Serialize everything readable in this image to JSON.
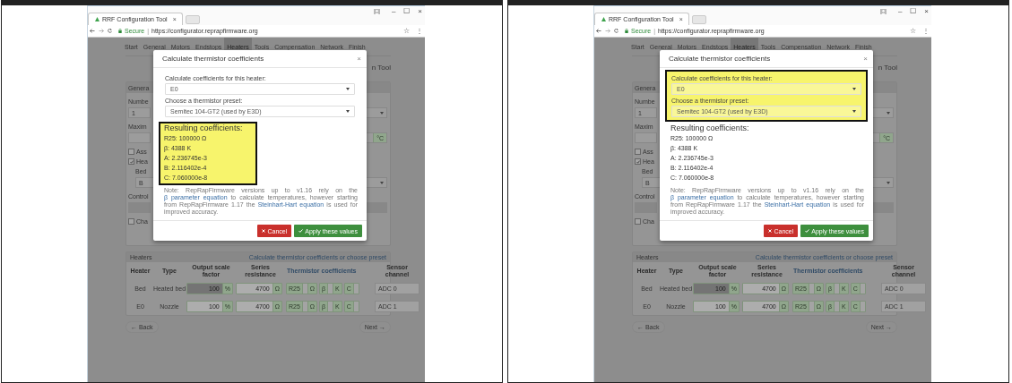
{
  "panels": [
    {
      "selectors_highlighted": false,
      "results_highlighted": true,
      "browser": {
        "tab_title": "RRF Configuration Tool",
        "tab_close": "×",
        "window_controls": [
          "–",
          "☐",
          "×"
        ],
        "secure_label": "Secure",
        "separator": "|",
        "url": "https://configurator.reprapfirmware.org",
        "star": "☆",
        "menu": "⋮"
      },
      "nav": [
        {
          "label": "Start",
          "selected": false
        },
        {
          "label": "General",
          "selected": false
        },
        {
          "label": "Motors",
          "selected": false
        },
        {
          "label": "Endstops",
          "selected": false
        },
        {
          "label": "Heaters",
          "selected": true
        },
        {
          "label": "Tools",
          "selected": false
        },
        {
          "label": "Compensation",
          "selected": false
        },
        {
          "label": "Network",
          "selected": false
        },
        {
          "label": "Finish",
          "selected": false
        }
      ],
      "page_title": "n Tool",
      "general": {
        "header": "Genera",
        "rows": [
          {
            "kind": "label",
            "text": "Numbe"
          },
          {
            "kind": "select",
            "text": "1"
          },
          {
            "kind": "label",
            "text": "Maxim"
          },
          {
            "kind": "input",
            "unit": "°C"
          },
          {
            "kind": "checkbox",
            "text": "Ass",
            "checked": false
          },
          {
            "kind": "checkbox",
            "text": "Hea",
            "checked": true
          },
          {
            "kind": "sublabel",
            "text": "Bed"
          },
          {
            "kind": "subselect",
            "text": "B"
          },
          {
            "kind": "label",
            "text": "Control"
          },
          {
            "kind": "bar"
          },
          {
            "kind": "checkbox",
            "text": "Cha",
            "checked": false
          }
        ]
      },
      "heaters": {
        "header": "Heaters",
        "link": "Calculate thermistor coefficients or choose preset",
        "columns": [
          "Heater",
          "Type",
          "Output scale factor",
          "Series resistance",
          "Thermistor coefficients",
          "Sensor channel"
        ],
        "rows": [
          {
            "heater": "Bed",
            "type": "Heated bed",
            "scale": "100",
            "scale_unit": "%",
            "scale_disabled": true,
            "resistance": "4700",
            "resistance_unit": "Ω",
            "coefficients": [
              {
                "label": "R25",
                "unit": "Ω"
              },
              {
                "label": "β",
                "unit": "K"
              },
              {
                "label": "C"
              }
            ],
            "sensor": "ADC 0"
          },
          {
            "heater": "E0",
            "type": "Nozzle",
            "scale": "100",
            "scale_unit": "%",
            "scale_disabled": false,
            "resistance": "4700",
            "resistance_unit": "Ω",
            "coefficients": [
              {
                "label": "R25",
                "unit": "Ω"
              },
              {
                "label": "β",
                "unit": "K"
              },
              {
                "label": "C"
              }
            ],
            "sensor": "ADC 1"
          }
        ]
      },
      "back": "← Back",
      "next": "Next →",
      "modal": {
        "title": "Calculate thermistor coefficients",
        "close": "×",
        "heater_label": "Calculate coefficients for this heater:",
        "heater_value": "E0",
        "preset_label": "Choose a thermistor preset:",
        "preset_value": "Semitec 104-GT2 (used by E3D)",
        "results_title": "Resulting coefficients:",
        "results": [
          "R25: 100000 Ω",
          "β: 4388 K",
          "A: 2.236745e-3",
          "B: 2.116402e-4",
          "C: 7.060000e-8"
        ],
        "note": [
          {
            "text": "Note: RepRapFirmware versions up to v1.16 rely on the ",
            "link": false
          },
          {
            "text": "β parameter equation",
            "link": true
          },
          {
            "text": " to calculate temperatures, however starting from RepRapFirmware 1.17 the ",
            "link": false
          },
          {
            "text": "Steinhart-Hart equation",
            "link": true
          },
          {
            "text": " is used for improved accuracy.",
            "link": false
          }
        ],
        "cancel": "Cancel",
        "apply": "Apply these values"
      }
    },
    {
      "selectors_highlighted": true,
      "results_highlighted": false,
      "browser": {
        "tab_title": "RRF Configuration Tool",
        "tab_close": "×",
        "window_controls": [
          "–",
          "☐",
          "×"
        ],
        "secure_label": "Secure",
        "separator": "|",
        "url": "https://configurator.reprapfirmware.org",
        "star": "☆",
        "menu": "⋮"
      },
      "nav": [
        {
          "label": "Start",
          "selected": false
        },
        {
          "label": "General",
          "selected": false
        },
        {
          "label": "Motors",
          "selected": false
        },
        {
          "label": "Endstops",
          "selected": false
        },
        {
          "label": "Heaters",
          "selected": true
        },
        {
          "label": "Tools",
          "selected": false
        },
        {
          "label": "Compensation",
          "selected": false
        },
        {
          "label": "Network",
          "selected": false
        },
        {
          "label": "Finish",
          "selected": false
        }
      ],
      "page_title": "n Tool",
      "general": {
        "header": "Genera",
        "rows": [
          {
            "kind": "label",
            "text": "Numbe"
          },
          {
            "kind": "select",
            "text": "1"
          },
          {
            "kind": "label",
            "text": "Maxim"
          },
          {
            "kind": "input",
            "unit": "°C"
          },
          {
            "kind": "checkbox",
            "text": "Ass",
            "checked": false
          },
          {
            "kind": "checkbox",
            "text": "Hea",
            "checked": true
          },
          {
            "kind": "sublabel",
            "text": "Bed"
          },
          {
            "kind": "subselect",
            "text": "B"
          },
          {
            "kind": "label",
            "text": "Control"
          },
          {
            "kind": "bar"
          },
          {
            "kind": "checkbox",
            "text": "Cha",
            "checked": false
          }
        ]
      },
      "heaters": {
        "header": "Heaters",
        "link": "Calculate thermistor coefficients or choose preset",
        "columns": [
          "Heater",
          "Type",
          "Output scale factor",
          "Series resistance",
          "Thermistor coefficients",
          "Sensor channel"
        ],
        "rows": [
          {
            "heater": "Bed",
            "type": "Heated bed",
            "scale": "100",
            "scale_unit": "%",
            "scale_disabled": true,
            "resistance": "4700",
            "resistance_unit": "Ω",
            "coefficients": [
              {
                "label": "R25",
                "unit": "Ω"
              },
              {
                "label": "β",
                "unit": "K"
              },
              {
                "label": "C"
              }
            ],
            "sensor": "ADC 0"
          },
          {
            "heater": "E0",
            "type": "Nozzle",
            "scale": "100",
            "scale_unit": "%",
            "scale_disabled": false,
            "resistance": "4700",
            "resistance_unit": "Ω",
            "coefficients": [
              {
                "label": "R25",
                "unit": "Ω"
              },
              {
                "label": "β",
                "unit": "K"
              },
              {
                "label": "C"
              }
            ],
            "sensor": "ADC 1"
          }
        ]
      },
      "back": "← Back",
      "next": "Next →",
      "modal": {
        "title": "Calculate thermistor coefficients",
        "close": "×",
        "heater_label": "Calculate coefficients for this heater:",
        "heater_value": "E0",
        "preset_label": "Choose a thermistor preset:",
        "preset_value": "Semitec 104-GT2 (used by E3D)",
        "results_title": "Resulting coefficients:",
        "results": [
          "R25: 100000 Ω",
          "β: 4388 K",
          "A: 2.236745e-3",
          "B: 2.116402e-4",
          "C: 7.060000e-8"
        ],
        "note": [
          {
            "text": "Note: RepRapFirmware versions up to v1.16 rely on the ",
            "link": false
          },
          {
            "text": "β parameter equation",
            "link": true
          },
          {
            "text": " to calculate temperatures, however starting from RepRapFirmware 1.17 the ",
            "link": false
          },
          {
            "text": "Steinhart-Hart equation",
            "link": true
          },
          {
            "text": " is used for improved accuracy.",
            "link": false
          }
        ],
        "cancel": "Cancel",
        "apply": "Apply these values"
      }
    }
  ]
}
